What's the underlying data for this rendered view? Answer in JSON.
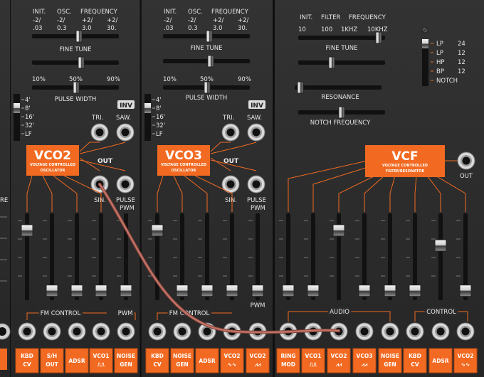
{
  "colors": {
    "panel": "#2b2b2b",
    "accent": "#f26a21",
    "text": "#e6e6e6",
    "cable": "#b5645a"
  },
  "vco2": {
    "headers": [
      "INIT.",
      "OSC.",
      "FREQUENCY"
    ],
    "range_top": [
      "-2/",
      "-2/",
      "+2/",
      "+2/"
    ],
    "range_bottom": [
      ".03",
      "0.3",
      "3.0",
      "30."
    ],
    "fine_tune": "FINE TUNE",
    "pw_ticks": [
      "10%",
      "50%",
      "90%"
    ],
    "pulse_width": "PULSE WIDTH",
    "octaves": [
      "4'",
      "8'",
      "16'",
      "32'",
      "LF"
    ],
    "inv": "INV",
    "tri": "TRI.",
    "saw": "SAW.",
    "out": "OUT",
    "sin": "SIN.",
    "pulse": "PULSE",
    "pwm_out": "PWM",
    "title": "VCO2",
    "sub1": "VOLTAGE CONTROLLED",
    "sub2": "OSCILLATOR",
    "fm_control": "FM CONTROL",
    "pwm": "PWM",
    "buttons": [
      [
        "KBD",
        "CV"
      ],
      [
        "S/H",
        "OUT"
      ],
      [
        "ADSR",
        ""
      ],
      [
        "VCO1",
        "⎍⎍"
      ],
      [
        "NOISE",
        "GEN"
      ]
    ],
    "slider_levels": [
      0.85,
      0.05,
      0.05,
      0.05,
      0.05
    ]
  },
  "vco3": {
    "headers": [
      "INIT.",
      "OSC.",
      "FREQUENCY"
    ],
    "range_top": [
      "-2/",
      "-2/",
      "+2/",
      "+2/"
    ],
    "range_bottom": [
      ".03",
      "0.3",
      "3.0",
      "30."
    ],
    "fine_tune": "FINE TUNE",
    "pw_ticks": [
      "10%",
      "50%",
      "90%"
    ],
    "pulse_width": "PULSE WIDTH",
    "octaves": [
      "4'",
      "8'",
      "16'",
      "32'",
      "LF"
    ],
    "inv": "INV",
    "tri": "TRI.",
    "saw": "SAW.",
    "out": "OUT",
    "sin": "SIN.",
    "pulse": "PULSE",
    "pwm_out": "PWM",
    "title": "VCO3",
    "sub1": "VOLTAGE CONTROLLED",
    "sub2": "OSCILLATOR",
    "fm_control": "FM CONTROL",
    "pwm": "PWM",
    "buttons": [
      [
        "KBD",
        "CV"
      ],
      [
        "NOISE",
        "GEN"
      ],
      [
        "ADSR",
        ""
      ],
      [
        "VCO2",
        "∿∿"
      ],
      [
        "VCO2",
        "⩘⩘"
      ]
    ],
    "slider_levels": [
      0.85,
      0.05,
      0.05,
      0.05,
      0.05
    ]
  },
  "vcf": {
    "headers": [
      "INIT.",
      "FILTER",
      "FREQUENCY"
    ],
    "freq_ticks": [
      "10",
      "100",
      "1KHZ",
      "10KHZ"
    ],
    "fine_tune": "FINE TUNE",
    "resonance": "RESONANCE",
    "notch": "NOTCH FREQUENCY",
    "modes": [
      [
        "LP",
        "24"
      ],
      [
        "LP",
        "12"
      ],
      [
        "HP",
        "12"
      ],
      [
        "BP",
        "12"
      ],
      [
        "NOTCH",
        ""
      ]
    ],
    "title": "VCF",
    "sub1": "VOLTAGE CONTROLLED",
    "sub2": "FILTER/RESONATOR",
    "out": "OUT",
    "audio": "AUDIO",
    "control": "CONTROL",
    "buttons": [
      [
        "RING",
        "MOD"
      ],
      [
        "VCO1",
        "⎍⎍"
      ],
      [
        "VCO2",
        "⩘⩘"
      ],
      [
        "VCO3",
        "⩘⩘"
      ],
      [
        "NOISE",
        "GEN"
      ],
      [
        "KBD",
        "CV"
      ],
      [
        "ADSR",
        ""
      ],
      [
        "VCO2",
        "∿∿"
      ]
    ],
    "slider_levels": [
      0.05,
      0.05,
      0.85,
      0.05,
      0.05,
      0.05,
      0.65,
      0.05
    ]
  }
}
